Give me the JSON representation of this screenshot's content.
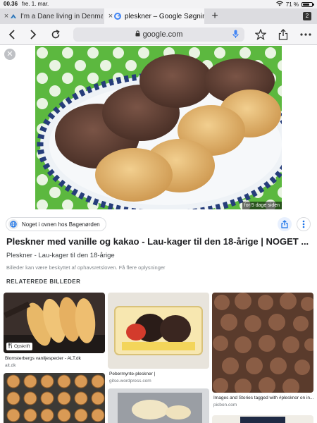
{
  "status_bar": {
    "time": "00.36",
    "date": "fre. 1. mar.",
    "battery": "71 %",
    "battery_level": 0.71
  },
  "tabs": [
    {
      "title": "I'm a Dane living in Denmar"
    },
    {
      "title": "pleskner – Google Søgning"
    }
  ],
  "tab_count": "2",
  "toolbar": {
    "url": "google.com"
  },
  "hero": {
    "age": "for 5 dage siden"
  },
  "source": {
    "label": "Noget i ovnen hos Bagenørden"
  },
  "result": {
    "title": "Pleskner med vanille og kakao - Lau-kager til den 18-årige | NOGET ...",
    "subtitle": "Pleskner - Lau-kager til den 18-årige",
    "note": "Billeder kan være beskyttet af ophavsretsloven. Få flere oplysninger"
  },
  "related": {
    "heading": "RELATEREDE BILLEDER",
    "items": [
      {
        "caption": "Blomsterbergs vaniljespecier - ALT.dk",
        "source": "alt.dk",
        "badge": "Opskrift"
      },
      {
        "caption": "Pebermynte-pleskner |",
        "source": "gitse.wordpress.com"
      },
      {
        "caption": "Images and Stories tagged with #plesknor on in...",
        "source": "picbon.com"
      }
    ]
  },
  "colors": {
    "accent": "#1a73e8",
    "chip_border": "#dadce0"
  }
}
